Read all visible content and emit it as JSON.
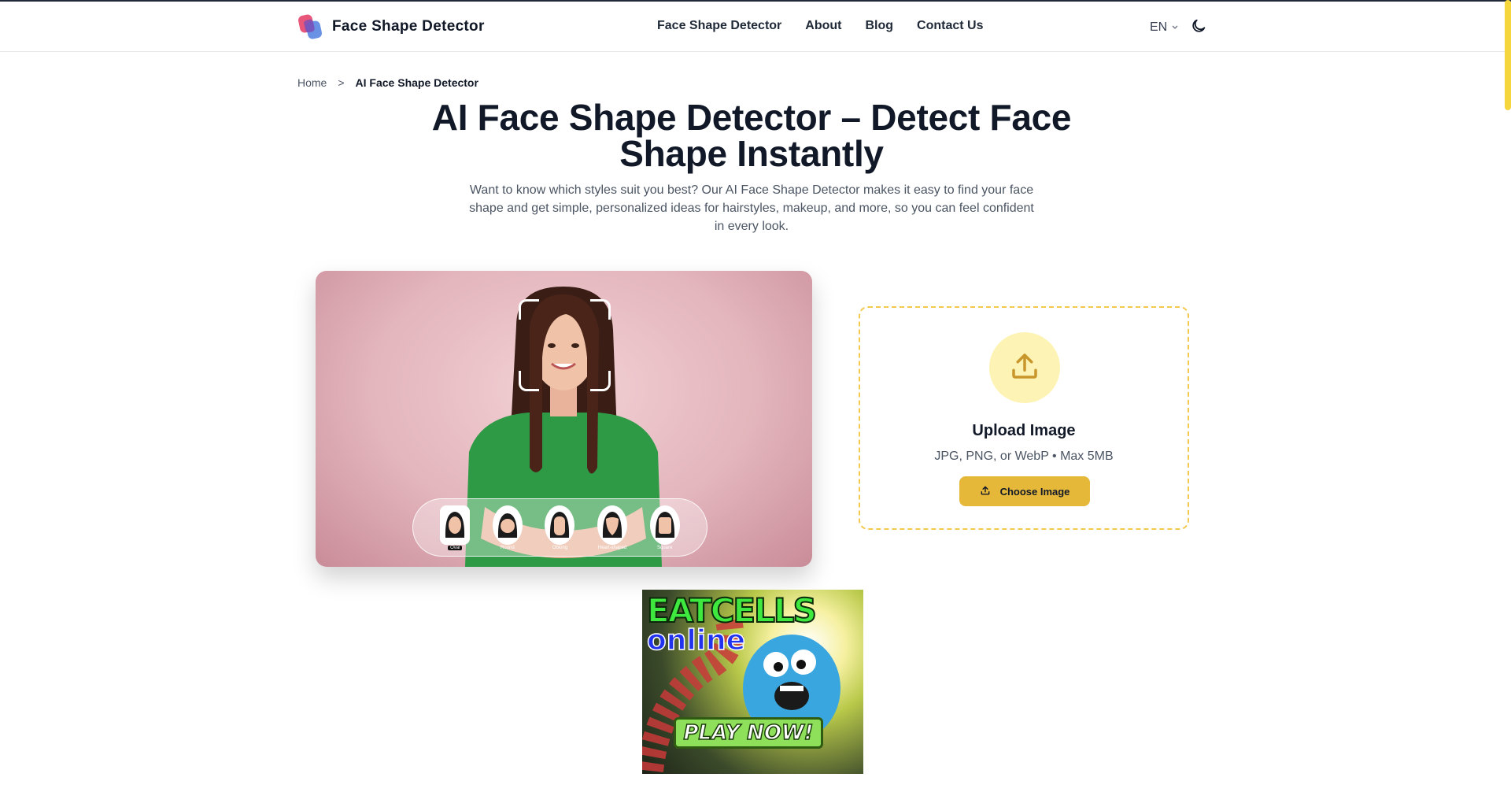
{
  "header": {
    "brand": "Face Shape Detector",
    "nav": [
      "Face Shape Detector",
      "About",
      "Blog",
      "Contact Us"
    ],
    "language": "EN"
  },
  "breadcrumb": {
    "home": "Home",
    "separator": ">",
    "current": "AI Face Shape Detector"
  },
  "hero": {
    "title": "AI Face Shape Detector – Detect Face Shape Instantly",
    "subtitle": "Want to know which styles suit you best? Our AI Face Shape Detector makes it easy to find your face shape and get simple, personalized ideas for hairstyles, makeup, and more, so you can feel confident in every look.",
    "shapes": [
      "Oval",
      "Round",
      "Oblong",
      "Heart-shaped",
      "Square"
    ]
  },
  "upload": {
    "title": "Upload Image",
    "hint": "JPG, PNG, or WebP • Max 5MB",
    "button": "Choose Image"
  },
  "ad": {
    "line1": "EATCELLS",
    "line2": "online",
    "cta": "PLAY NOW!"
  },
  "colors": {
    "accent": "#e5b83a",
    "upload_border": "#f3c94e",
    "upload_circle": "#fdf3b5",
    "icon": "#c8962a"
  },
  "icons": {
    "logo": "face-shape-logo-icon",
    "theme": "moon-icon",
    "language_chevron": "chevron-down-icon",
    "upload": "upload-icon"
  }
}
